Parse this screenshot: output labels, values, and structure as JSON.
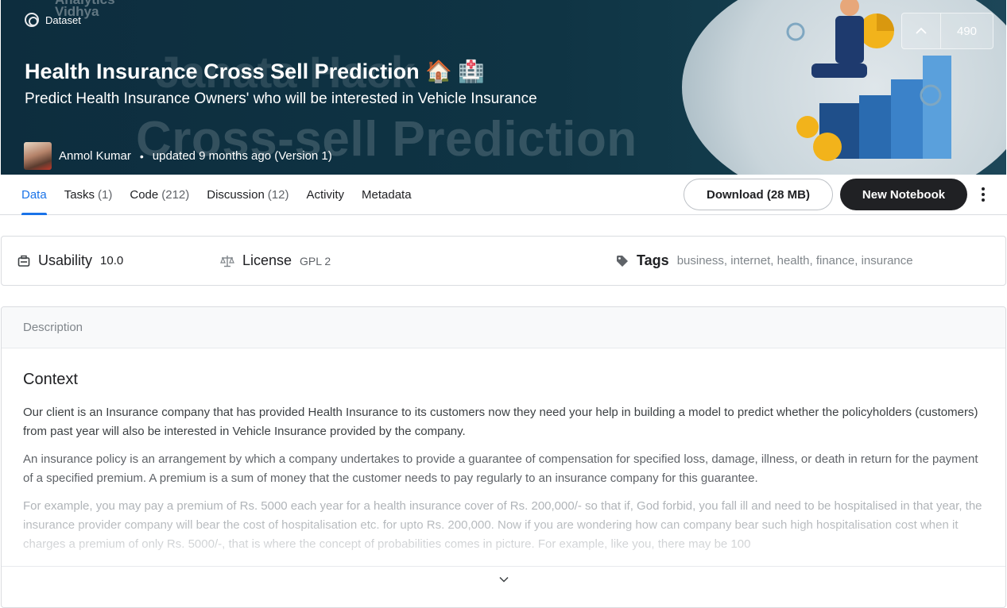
{
  "banner": {
    "type_label": "Dataset",
    "title": "Health Insurance Cross Sell Prediction 🏠 🏥",
    "subtitle": "Predict Health Insurance Owners' who will be interested in Vehicle Insurance",
    "bg_text_top": "Janata Hack",
    "bg_text": "Cross-sell Prediction",
    "watermark": "Analytics\nVidhya",
    "author": "Anmol Kumar",
    "updated": "updated 9 months ago (Version 1)",
    "upvotes": "490",
    "colors": {
      "banner_bg": "#0f3444",
      "accent_gold": "#f2b31b"
    }
  },
  "tabs": [
    {
      "label": "Data",
      "count": ""
    },
    {
      "label": "Tasks",
      "count": "(1)"
    },
    {
      "label": "Code",
      "count": "(212)"
    },
    {
      "label": "Discussion",
      "count": "(12)"
    },
    {
      "label": "Activity",
      "count": ""
    },
    {
      "label": "Metadata",
      "count": ""
    }
  ],
  "actions": {
    "download_label": "Download (28 MB)",
    "new_notebook_label": "New Notebook"
  },
  "meta": {
    "usability_label": "Usability",
    "usability_value": "10.0",
    "license_label": "License",
    "license_value": "GPL 2",
    "tags_label": "Tags",
    "tags": [
      "business",
      "internet",
      "health",
      "finance",
      "insurance"
    ]
  },
  "description": {
    "header": "Description",
    "heading": "Context",
    "paragraphs": [
      "Our client is an Insurance company that has provided Health Insurance to its customers now they need your help in building a model to predict whether the policyholders (customers) from past year will also be interested in Vehicle Insurance provided by the company.",
      "An insurance policy is an arrangement by which a company undertakes to provide a guarantee of compensation for specified loss, damage, illness, or death in return for the payment of a specified premium. A premium is a sum of money that the customer needs to pay regularly to an insurance company for this guarantee.",
      "For example, you may pay a premium of Rs. 5000 each year for a health insurance cover of Rs. 200,000/- so that if, God forbid, you fall ill and need to be hospitalised in that year, the insurance provider company will bear the cost of hospitalisation etc. for upto Rs. 200,000. Now if you are wondering how can company bear such high hospitalisation cost when it charges a premium of only Rs. 5000/-, that is where the concept of probabilities comes in picture. For example, like you, there may be 100"
    ]
  },
  "colors": {
    "accent": "#1a73e8",
    "dark_button": "#202124"
  }
}
